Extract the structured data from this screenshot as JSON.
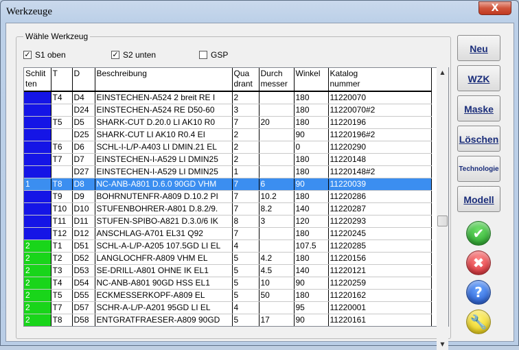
{
  "window": {
    "title": "Werkzeuge",
    "close_label": "X"
  },
  "group": {
    "legend": "Wähle Werkzeug",
    "checks": [
      {
        "label": "S1 oben",
        "checked": true
      },
      {
        "label": "S2 unten",
        "checked": true
      },
      {
        "label": "GSP",
        "checked": false
      }
    ]
  },
  "table": {
    "columns": [
      {
        "key": "sl",
        "label": "Schlit\nten"
      },
      {
        "key": "t",
        "label": "T"
      },
      {
        "key": "d",
        "label": "D"
      },
      {
        "key": "desc",
        "label": "Beschreibung"
      },
      {
        "key": "q",
        "label": "Qua\ndrant"
      },
      {
        "key": "dm",
        "label": "Durch\nmesser"
      },
      {
        "key": "w",
        "label": "Winkel"
      },
      {
        "key": "k",
        "label": "Katalog\nnummer"
      }
    ],
    "rows": [
      {
        "sl": "",
        "slot": "blue",
        "t": "T4",
        "d": "D4",
        "desc": "EINSTECHEN-A524  2 breit  RE  I",
        "q": "2",
        "dm": "",
        "w": "180",
        "k": "11220070"
      },
      {
        "sl": "",
        "slot": "blue",
        "t": "",
        "d": "D24",
        "desc": "EINSTECHEN-A524 RE  D50-60",
        "q": "3",
        "dm": "",
        "w": "180",
        "k": "11220070#2"
      },
      {
        "sl": "",
        "slot": "blue",
        "t": "T5",
        "d": "D5",
        "desc": "SHARK-CUT D.20.0  LI  AK10  R0",
        "q": "7",
        "dm": "20",
        "w": "180",
        "k": "11220196"
      },
      {
        "sl": "",
        "slot": "blue",
        "t": "",
        "d": "D25",
        "desc": "SHARK-CUT LI  AK10  R0.4      EI",
        "q": "2",
        "dm": "",
        "w": "90",
        "k": "11220196#2"
      },
      {
        "sl": "",
        "slot": "blue",
        "t": "T6",
        "d": "D6",
        "desc": "SCHL-I-L/P-A403 LI  DMIN.21    EL",
        "q": "2",
        "dm": "",
        "w": "0",
        "k": "11220290"
      },
      {
        "sl": "",
        "slot": "blue",
        "t": "T7",
        "d": "D7",
        "desc": "EINSTECHEN-I-A529 LI  DMIN25",
        "q": "2",
        "dm": "",
        "w": "180",
        "k": "11220148"
      },
      {
        "sl": "",
        "slot": "blue",
        "t": "",
        "d": "D27",
        "desc": "EINSTECHEN-I-A529 LI  DMIN25",
        "q": "1",
        "dm": "",
        "w": "180",
        "k": "11220148#2"
      },
      {
        "sl": "1",
        "slot": "blue",
        "t": "T8",
        "d": "D8",
        "desc": "NC-ANB-A801 D.6.0   90GD VHM",
        "q": "7",
        "dm": "6",
        "w": "90",
        "k": "11220039",
        "selected": true
      },
      {
        "sl": "",
        "slot": "blue",
        "t": "T9",
        "d": "D9",
        "desc": "BOHRNUTENFR-A809 D.10.2  PI",
        "q": "7",
        "dm": "10.2",
        "w": "180",
        "k": "11220286"
      },
      {
        "sl": "",
        "slot": "blue",
        "t": "T10",
        "d": "D10",
        "desc": "STUFENBOHRER-A801 D.8.2/9.",
        "q": "7",
        "dm": "8.2",
        "w": "140",
        "k": "11220287"
      },
      {
        "sl": "",
        "slot": "blue",
        "t": "T11",
        "d": "D11",
        "desc": "STUFEN-SPIBO-A821 D.3.0/6  IK",
        "q": "8",
        "dm": "3",
        "w": "120",
        "k": "11220293"
      },
      {
        "sl": "",
        "slot": "blue",
        "t": "T12",
        "d": "D12",
        "desc": "ANSCHLAG-A701       EL31  Q92",
        "q": "7",
        "dm": "",
        "w": "180",
        "k": "11220245"
      },
      {
        "sl": "2",
        "slot": "green",
        "t": "T1",
        "d": "D51",
        "desc": "SCHL-A-L/P-A205 107.5GD LI   EL",
        "q": "4",
        "dm": "",
        "w": "107.5",
        "k": "11220285"
      },
      {
        "sl": "2",
        "slot": "green",
        "t": "T2",
        "d": "D52",
        "desc": "LANGLOCHFR-A809  VHM      EL",
        "q": "5",
        "dm": "4.2",
        "w": "180",
        "k": "11220156"
      },
      {
        "sl": "2",
        "slot": "green",
        "t": "T3",
        "d": "D53",
        "desc": "SE-DRILL-A801  OHNE IK      EL1",
        "q": "5",
        "dm": "4.5",
        "w": "140",
        "k": "11220121"
      },
      {
        "sl": "2",
        "slot": "green",
        "t": "T4",
        "d": "D54",
        "desc": "NC-ANB-A801 90GD HSS      EL1",
        "q": "5",
        "dm": "10",
        "w": "90",
        "k": "11220259"
      },
      {
        "sl": "2",
        "slot": "green",
        "t": "T5",
        "d": "D55",
        "desc": "ECKMESSERKOPF-A809        EL",
        "q": "5",
        "dm": "50",
        "w": "180",
        "k": "11220162"
      },
      {
        "sl": "2",
        "slot": "green",
        "t": "T7",
        "d": "D57",
        "desc": "SCHR-A-L/P-A201  95GD LI   EL",
        "q": "4",
        "dm": "",
        "w": "95",
        "k": "11220001"
      },
      {
        "sl": "2",
        "slot": "green",
        "t": "T8",
        "d": "D58",
        "desc": "ENTGRATFRAESER-A809 90GD",
        "q": "5",
        "dm": "17",
        "w": "90",
        "k": "11220161"
      }
    ]
  },
  "buttons": {
    "neu": "Neu",
    "wzk": "WZK",
    "maske": "Maske",
    "loeschen": "Löschen",
    "technologie": "Technologie",
    "modell": "Modell"
  },
  "icons": {
    "ok": "checkmark-icon",
    "cancel": "x-icon",
    "help": "question-icon",
    "tools": "wrench-icon"
  },
  "colors": {
    "slide1": "#1515e6",
    "slide2": "#19d51a",
    "selection": "#3b8ef0"
  }
}
